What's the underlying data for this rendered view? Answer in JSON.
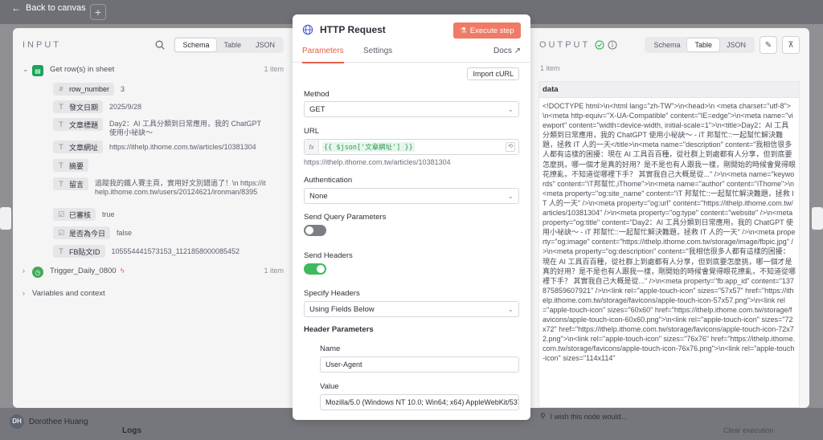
{
  "canvas": {
    "back_label": "Back to canvas",
    "plus": "+",
    "user_initials": "DH",
    "user_name": "Dorothee Huang",
    "logs_label": "Logs",
    "clear_label": "Clear execution"
  },
  "input": {
    "title": "INPUT",
    "tabs": [
      "Schema",
      "Table",
      "JSON"
    ],
    "active_tab": "Schema",
    "nodes": [
      {
        "name": "Get row(s) in sheet",
        "count": "1 item",
        "expanded": true,
        "color": "#1aa35a"
      },
      {
        "name": "Trigger_Daily_0800",
        "count": "1 item",
        "expanded": false,
        "color": "#41a957"
      },
      {
        "name": "Variables and context",
        "count": "",
        "expanded": false
      }
    ],
    "fields": [
      {
        "type": "#",
        "key": "row_number",
        "value": "3"
      },
      {
        "type": "T",
        "key": "發文日期",
        "value": "2025/9/28"
      },
      {
        "type": "T",
        "key": "文章標題",
        "value": "Day2：AI 工具分類到日常應用，我的 ChatGPT 使用小祕訣～"
      },
      {
        "type": "T",
        "key": "文章網址",
        "value": "https://ithelp.ithome.com.tw/articles/10381304"
      },
      {
        "type": "T",
        "key": "摘要",
        "value": ""
      },
      {
        "type": "T",
        "key": "留言",
        "value": "追蹤我的鐵人賽主頁，實用好文別錯過了！\\n https://ithelp.ithome.com.tw/users/20124621/ironman/8395"
      },
      {
        "type": "☑",
        "key": "已審核",
        "value": "true"
      },
      {
        "type": "☑",
        "key": "是否為今日",
        "value": "false"
      },
      {
        "type": "T",
        "key": "FB貼文ID",
        "value": "105554441573153_1121858000085452"
      }
    ]
  },
  "node": {
    "title": "HTTP Request",
    "execute_label": "Execute step",
    "tabs": [
      "Parameters",
      "Settings"
    ],
    "docs_label": "Docs",
    "import_curl": "Import cURL",
    "method_label": "Method",
    "method_value": "GET",
    "url_label": "URL",
    "url_expression": "{{ $json['文章網址'] }}",
    "url_resolved": "https://ithelp.ithome.com.tw/articles/10381304",
    "auth_label": "Authentication",
    "auth_value": "None",
    "query_label": "Send Query Parameters",
    "query_on": false,
    "headers_label": "Send Headers",
    "headers_on": true,
    "specify_label": "Specify Headers",
    "specify_value": "Using Fields Below",
    "header_params_label": "Header Parameters",
    "name_label": "Name",
    "name_value": "User-Agent",
    "value_label": "Value",
    "value_value": "Mozilla/5.0 (Windows NT 10.0; Win64; x64) AppleWebKit/537.36"
  },
  "output": {
    "title": "OUTPUT",
    "tabs": [
      "Schema",
      "Table",
      "JSON"
    ],
    "active_tab": "Table",
    "count": "1 item",
    "column": "data",
    "data": "<!DOCTYPE html>\\n<html lang=\"zh-TW\">\\n<head>\\n   <meta charset=\"utf-8\">\\n<meta http-equiv=\"X-UA-Compatible\" content=\"IE=edge\">\\n<meta name=\"viewport\" content=\"width=device-width, initial-scale=1\">\\n<title>Day2：AI 工具分類到日常應用，我的 ChatGPT 使用小祕訣～ - iT 邦幫忙::一起幫忙解決難題，拯救 IT 人的一天</title>\\n<meta name=\"description\"      content=\"我相信很多人都有這樣的困擾：現在 AI 工具百百種，從社群上到處都有人分享，但到底要怎麼挑，哪一個才是真的好用？是不是也有人跟我一樣，剛開始的時候會覺得眼花撩亂，不知道從哪裡下手？ 其實我自己大概是從...\" />\\n<meta name=\"keywords\" content=\"iT邦幫忙,iThome\">\\n<meta name=\"author\" content=\"iThome\">\\n<meta property=\"og:site_name\" content=\"iT 邦幫忙::一起幫忙解決難題，拯救 IT 人的一天\" />\\n<meta property=\"og:url\" content=\"https://ithelp.ithome.com.tw/articles/10381304\" />\\n<meta property=\"og:type\" content=\"website\" />\\n<meta property=\"og:title\" content=\"Day2：AI 工具分類到日常應用，我的 ChatGPT 使用小祕訣～ - iT 邦幫忙::一起幫忙解決難題，拯救 IT 人的一天\" />\\n<meta property=\"og:image\" content=\"https://ithelp.ithome.com.tw/storage/image/fbpic.jpg\" />\\n<meta property=\"og:description\"      content=\"我相信很多人都有這樣的困擾：現在 AI 工具百百種，從社群上到處都有人分享，但到底要怎麼挑，哪一個才是真的好用？是不是也有人跟我一樣，剛開始的時候會覺得眼花撩亂，不知道從哪裡下手？ 其實我自己大概是從...\" />\\n<meta property=\"fb:app_id\" content=\"137875859607921\" />\\n<link rel=\"apple-touch-icon\" sizes=\"57x57\" href=\"https://ithelp.ithome.com.tw/storage/favicons/apple-touch-icon-57x57.png\">\\n<link rel=\"apple-touch-icon\" sizes=\"60x60\" href=\"https://ithelp.ithome.com.tw/storage/favicons/apple-touch-icon-60x60.png\">\\n<link rel=\"apple-touch-icon\" sizes=\"72x72\" href=\"https://ithelp.ithome.com.tw/storage/favicons/apple-touch-icon-72x72.png\">\\n<link rel=\"apple-touch-icon\" sizes=\"76x76\" href=\"https://ithelp.ithome.com.tw/storage/favicons/apple-touch-icon-76x76.png\">\\n<link rel=\"apple-touch-icon\" sizes=\"114x114\"",
    "wish_label": "I wish this node would..."
  },
  "colors": {
    "accent": "#e0614a",
    "execute": "#ef7b67",
    "toggle_on": "#3fb95e",
    "success": "#3fb95e"
  }
}
